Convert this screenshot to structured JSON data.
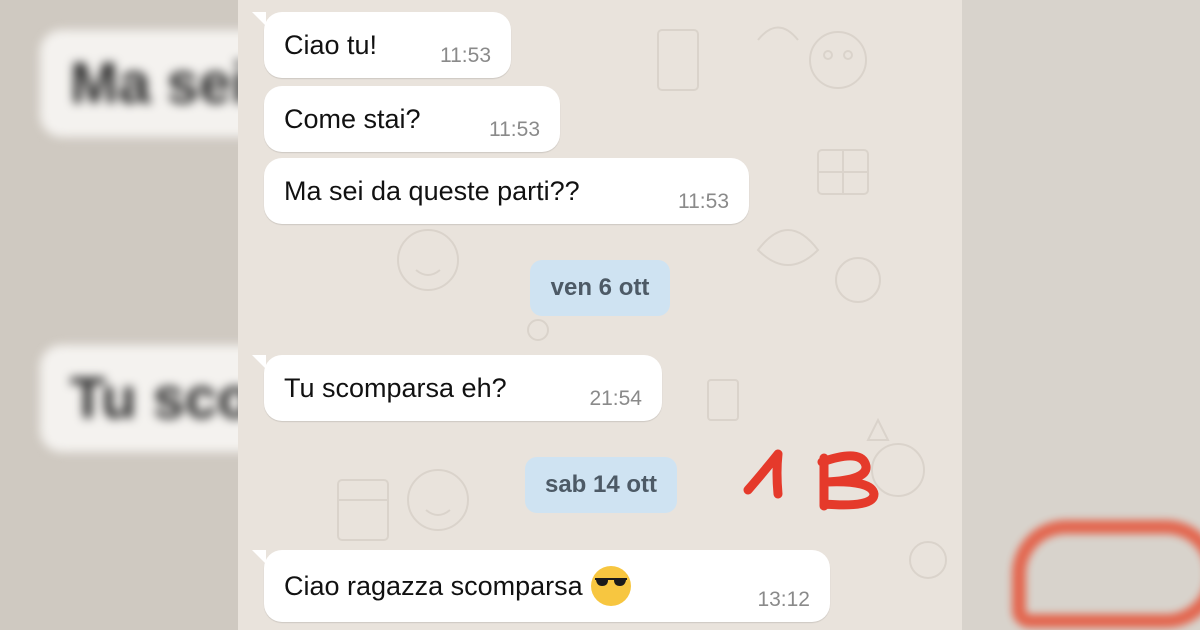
{
  "blurred": {
    "left_top": "Ma sei",
    "left_middle": "Tu scor"
  },
  "messages": [
    {
      "text": "Ciao tu!",
      "time": "11:53"
    },
    {
      "text": "Come stai?",
      "time": "11:53"
    },
    {
      "text": "Ma sei da queste parti??",
      "time": "11:53"
    },
    {
      "text": "Tu scomparsa eh?",
      "time": "21:54"
    },
    {
      "text": "Ciao ragazza scomparsa",
      "time": "13:12",
      "emoji": "sunglasses-face"
    }
  ],
  "dates": [
    {
      "label": "ven 6 ott"
    },
    {
      "label": "sab 14 ott"
    }
  ],
  "annotation": {
    "text": "1B",
    "color": "#e53a2b"
  },
  "colors": {
    "chat_bg": "#e9e3dc",
    "bubble": "#ffffff",
    "date_chip": "#cfe3f2"
  }
}
